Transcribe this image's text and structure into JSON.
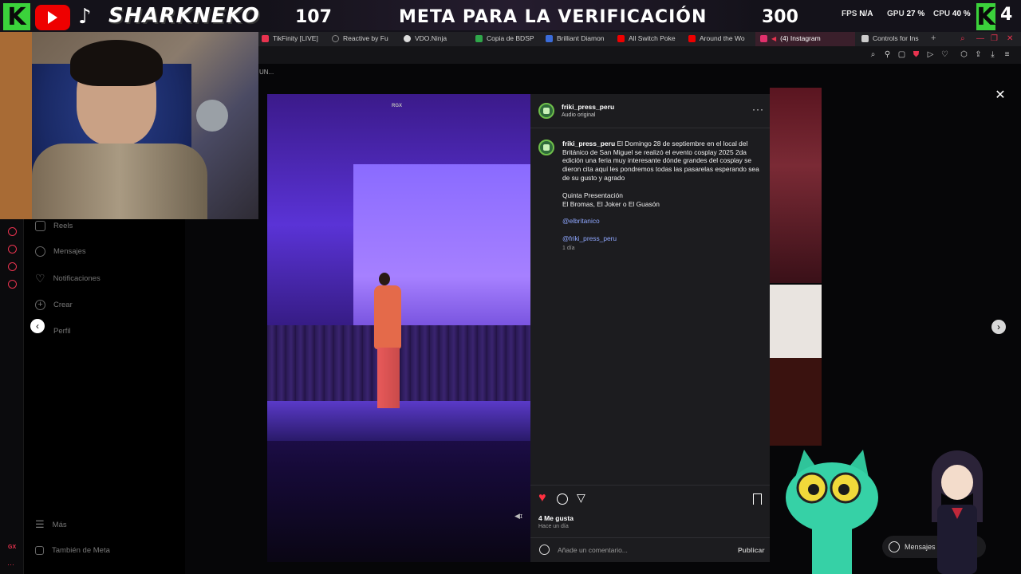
{
  "overlay": {
    "brand": "SHARKNEKO",
    "follower_count": "107",
    "goal_title": "META PARA LA VERIFICACIÓN",
    "goal_target": "300",
    "right_badge": "4",
    "fps_label": "FPS",
    "fps_value": "N/A",
    "gpu_label": "GPU",
    "gpu_value": "27 %",
    "cpu_label": "CPU",
    "cpu_value": "40 %",
    "accent_green": "#3bd23b"
  },
  "browser": {
    "tabs": [
      {
        "label": "TikFinity [LIVE]",
        "icon": "tikfinity-icon",
        "color": "#e8334f"
      },
      {
        "label": "Reactive by Fu",
        "icon": "reactive-icon",
        "color": "#888888"
      },
      {
        "label": "VDO.Ninja",
        "icon": "vdoninja-icon",
        "color": "#dddddd"
      },
      {
        "label": "Copia de BDSP",
        "icon": "sheets-icon",
        "color": "#2fa64a"
      },
      {
        "label": "Brilliant Diamon",
        "icon": "brilliant-icon",
        "color": "#3a6bd9"
      },
      {
        "label": "All Switch Poke",
        "icon": "youtube-icon",
        "color": "#e00000"
      },
      {
        "label": "Around the Wo",
        "icon": "youtube-icon",
        "color": "#e00000"
      },
      {
        "label": "(4) Instagram",
        "icon": "instagram-icon",
        "color": "#e1306c",
        "active": true
      },
      {
        "label": "Controls for Ins",
        "icon": "extension-icon",
        "color": "#cccccc"
      }
    ],
    "url_fragment": "UN..."
  },
  "instagram_nav": {
    "items": [
      {
        "label": "Reels",
        "icon": "reels-icon"
      },
      {
        "label": "Mensajes",
        "icon": "messages-icon"
      },
      {
        "label": "Notificaciones",
        "icon": "heart-icon"
      },
      {
        "label": "Crear",
        "icon": "plus-icon"
      },
      {
        "label": "Perfil",
        "icon": "profile-icon"
      }
    ],
    "more_label": "Más",
    "meta_label": "También de Meta"
  },
  "post": {
    "username": "friki_press_peru",
    "audio_label": "Audio original",
    "caption_user": "friki_press_peru",
    "caption_text": "El Domingo 28 de septiembre en el local del Británico de San Miguel se realizó el evento cosplay 2025 2da edición una feria muy interesante dónde grandes del cosplay se dieron cita aquí les pondremos todas las pasarelas esperando sea de su gusto y agrado",
    "caption_line2": "Quinta Presentación",
    "caption_line3": "El Bromas, El Joker o El Guasón",
    "mention1": "@elbritanico",
    "mention2": "@friki_press_peru",
    "caption_time": "1 día",
    "likes": "4 Me gusta",
    "post_time": "Hace un día",
    "comment_placeholder": "Añade un comentario...",
    "publish_label": "Publicar",
    "video_watermark": "RGX"
  },
  "floating": {
    "messages_label": "Mensajes"
  }
}
